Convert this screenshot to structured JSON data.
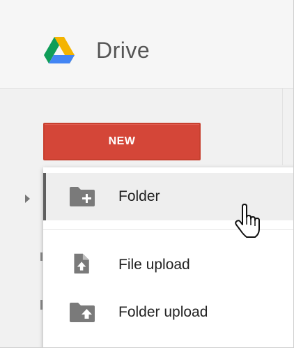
{
  "header": {
    "app_title": "Drive"
  },
  "toolbar": {
    "new_label": "NEW"
  },
  "menu": {
    "items": [
      {
        "label": "Folder",
        "icon": "folder-plus-icon",
        "state": "hover"
      },
      {
        "label": "File upload",
        "icon": "file-upload-icon"
      },
      {
        "label": "Folder upload",
        "icon": "folder-upload-icon"
      }
    ]
  },
  "colors": {
    "new_button": "#d44638",
    "icon_gray": "#7a7a7a",
    "logo_green": "#0f9d58",
    "logo_yellow": "#f4b400",
    "logo_blue": "#4285f4"
  }
}
